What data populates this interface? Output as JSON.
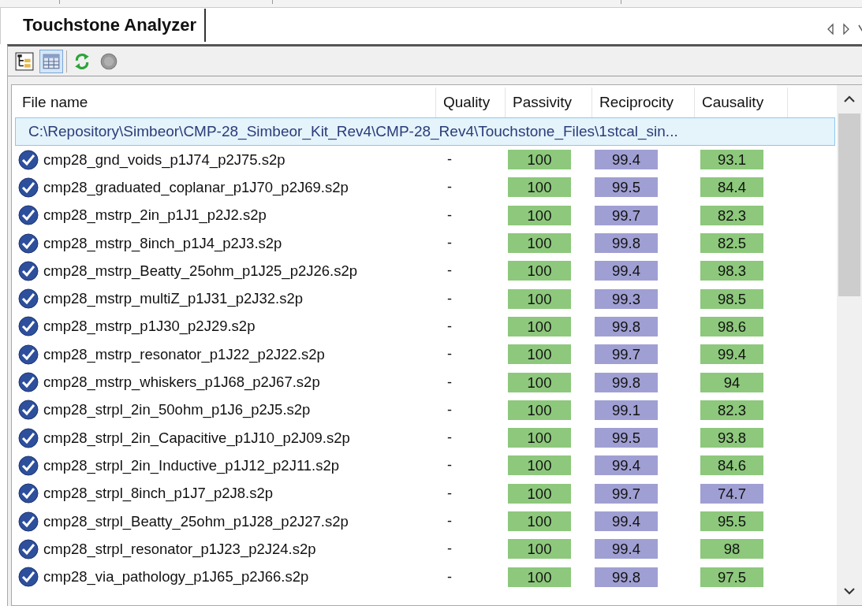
{
  "tab": {
    "label": "Touchstone Analyzer",
    "selected": true
  },
  "toolbar": [
    {
      "kind": "tree",
      "selected": false
    },
    {
      "kind": "table",
      "selected": true
    },
    {
      "kind": "refresh",
      "disabled": false
    },
    {
      "kind": "stop",
      "disabled": true
    }
  ],
  "table": {
    "columns": [
      "File name",
      "Quality",
      "Passivity",
      "Reciprocity",
      "Causality"
    ],
    "group_row": "C:\\Repository\\Simbeor\\CMP-28_Simbeor_Kit_Rev4\\CMP-28_Rev4\\Touchstone_Files\\1stcal_sin...",
    "rows": [
      {
        "file_name": "cmp28_gnd_voids_p1J74_p2J75.s2p",
        "quality": "-",
        "passivity": {
          "text": "100",
          "color": "#8dc87c"
        },
        "reciprocity": {
          "text": "99.4",
          "color": "#a09fd3"
        },
        "causality": {
          "text": "93.1",
          "color": "#8dc87c"
        }
      },
      {
        "file_name": "cmp28_graduated_coplanar_p1J70_p2J69.s2p",
        "quality": "-",
        "passivity": {
          "text": "100",
          "color": "#8dc87c"
        },
        "reciprocity": {
          "text": "99.5",
          "color": "#a09fd3"
        },
        "causality": {
          "text": "84.4",
          "color": "#8dc87c"
        }
      },
      {
        "file_name": "cmp28_mstrp_2in_p1J1_p2J2.s2p",
        "quality": "-",
        "passivity": {
          "text": "100",
          "color": "#8dc87c"
        },
        "reciprocity": {
          "text": "99.7",
          "color": "#a09fd3"
        },
        "causality": {
          "text": "82.3",
          "color": "#8dc87c"
        }
      },
      {
        "file_name": "cmp28_mstrp_8inch_p1J4_p2J3.s2p",
        "quality": "-",
        "passivity": {
          "text": "100",
          "color": "#8dc87c"
        },
        "reciprocity": {
          "text": "99.8",
          "color": "#a09fd3"
        },
        "causality": {
          "text": "82.5",
          "color": "#8dc87c"
        }
      },
      {
        "file_name": "cmp28_mstrp_Beatty_25ohm_p1J25_p2J26.s2p",
        "quality": "-",
        "passivity": {
          "text": "100",
          "color": "#8dc87c"
        },
        "reciprocity": {
          "text": "99.4",
          "color": "#a09fd3"
        },
        "causality": {
          "text": "98.3",
          "color": "#8dc87c"
        }
      },
      {
        "file_name": "cmp28_mstrp_multiZ_p1J31_p2J32.s2p",
        "quality": "-",
        "passivity": {
          "text": "100",
          "color": "#8dc87c"
        },
        "reciprocity": {
          "text": "99.3",
          "color": "#a09fd3"
        },
        "causality": {
          "text": "98.5",
          "color": "#8dc87c"
        }
      },
      {
        "file_name": "cmp28_mstrp_p1J30_p2J29.s2p",
        "quality": "-",
        "passivity": {
          "text": "100",
          "color": "#8dc87c"
        },
        "reciprocity": {
          "text": "99.8",
          "color": "#a09fd3"
        },
        "causality": {
          "text": "98.6",
          "color": "#8dc87c"
        }
      },
      {
        "file_name": "cmp28_mstrp_resonator_p1J22_p2J22.s2p",
        "quality": "-",
        "passivity": {
          "text": "100",
          "color": "#8dc87c"
        },
        "reciprocity": {
          "text": "99.7",
          "color": "#a09fd3"
        },
        "causality": {
          "text": "99.4",
          "color": "#8dc87c"
        }
      },
      {
        "file_name": "cmp28_mstrp_whiskers_p1J68_p2J67.s2p",
        "quality": "-",
        "passivity": {
          "text": "100",
          "color": "#8dc87c"
        },
        "reciprocity": {
          "text": "99.8",
          "color": "#a09fd3"
        },
        "causality": {
          "text": "94",
          "color": "#8dc87c"
        }
      },
      {
        "file_name": "cmp28_strpl_2in_50ohm_p1J6_p2J5.s2p",
        "quality": "-",
        "passivity": {
          "text": "100",
          "color": "#8dc87c"
        },
        "reciprocity": {
          "text": "99.1",
          "color": "#a09fd3"
        },
        "causality": {
          "text": "82.3",
          "color": "#8dc87c"
        }
      },
      {
        "file_name": "cmp28_strpl_2in_Capacitive_p1J10_p2J09.s2p",
        "quality": "-",
        "passivity": {
          "text": "100",
          "color": "#8dc87c"
        },
        "reciprocity": {
          "text": "99.5",
          "color": "#a09fd3"
        },
        "causality": {
          "text": "93.8",
          "color": "#8dc87c"
        }
      },
      {
        "file_name": "cmp28_strpl_2in_Inductive_p1J12_p2J11.s2p",
        "quality": "-",
        "passivity": {
          "text": "100",
          "color": "#8dc87c"
        },
        "reciprocity": {
          "text": "99.4",
          "color": "#a09fd3"
        },
        "causality": {
          "text": "84.6",
          "color": "#8dc87c"
        }
      },
      {
        "file_name": "cmp28_strpl_8inch_p1J7_p2J8.s2p",
        "quality": "-",
        "passivity": {
          "text": "100",
          "color": "#8dc87c"
        },
        "reciprocity": {
          "text": "99.7",
          "color": "#a09fd3"
        },
        "causality": {
          "text": "74.7",
          "color": "#a09fd3"
        }
      },
      {
        "file_name": "cmp28_strpl_Beatty_25ohm_p1J28_p2J27.s2p",
        "quality": "-",
        "passivity": {
          "text": "100",
          "color": "#8dc87c"
        },
        "reciprocity": {
          "text": "99.4",
          "color": "#a09fd3"
        },
        "causality": {
          "text": "95.5",
          "color": "#8dc87c"
        }
      },
      {
        "file_name": "cmp28_strpl_resonator_p1J23_p2J24.s2p",
        "quality": "-",
        "passivity": {
          "text": "100",
          "color": "#8dc87c"
        },
        "reciprocity": {
          "text": "99.4",
          "color": "#a09fd3"
        },
        "causality": {
          "text": "98",
          "color": "#8dc87c"
        }
      },
      {
        "file_name": "cmp28_via_pathology_p1J65_p2J66.s2p",
        "quality": "-",
        "passivity": {
          "text": "100",
          "color": "#8dc87c"
        },
        "reciprocity": {
          "text": "99.8",
          "color": "#a09fd3"
        },
        "causality": {
          "text": "97.5",
          "color": "#8dc87c"
        }
      }
    ]
  }
}
